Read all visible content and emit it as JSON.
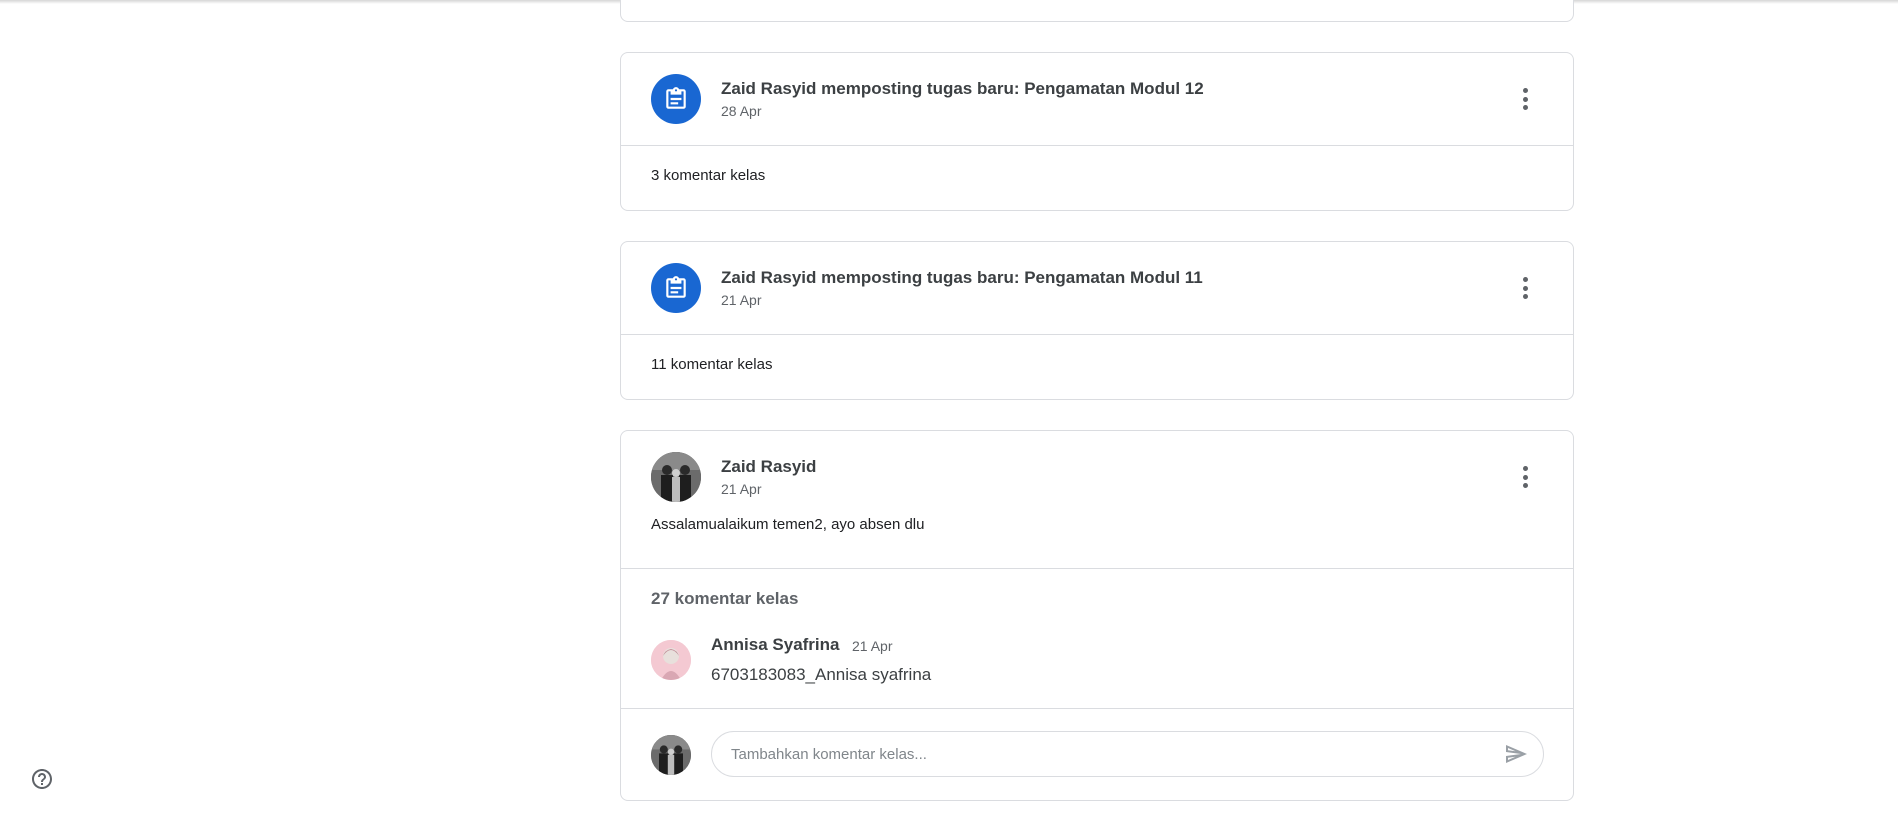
{
  "feed": {
    "posts": [
      {
        "type": "assignment",
        "title": "Zaid Rasyid memposting tugas baru: Pengamatan Modul 12",
        "date": "28 Apr",
        "comments": "3 komentar kelas"
      },
      {
        "type": "assignment",
        "title": "Zaid Rasyid memposting tugas baru: Pengamatan Modul 11",
        "date": "21 Apr",
        "comments": "11 komentar kelas"
      },
      {
        "type": "announcement",
        "author": "Zaid Rasyid",
        "date": "21 Apr",
        "body": "Assalamualaikum temen2, ayo absen dlu",
        "comments_title": "27 komentar kelas",
        "latest_comment": {
          "author": "Annisa Syafrina",
          "date": "21 Apr",
          "text": "6703183083_Annisa syafrina"
        },
        "comment_input_placeholder": "Tambahkan komentar kelas..."
      }
    ]
  },
  "icons": {
    "assignment": "assignment-icon",
    "more": "more-vert-icon",
    "send": "send-icon",
    "help": "help-icon"
  },
  "colors": {
    "accent": "#1967d2",
    "border": "#dadce0",
    "text": "#202124",
    "muted": "#5f6368"
  }
}
